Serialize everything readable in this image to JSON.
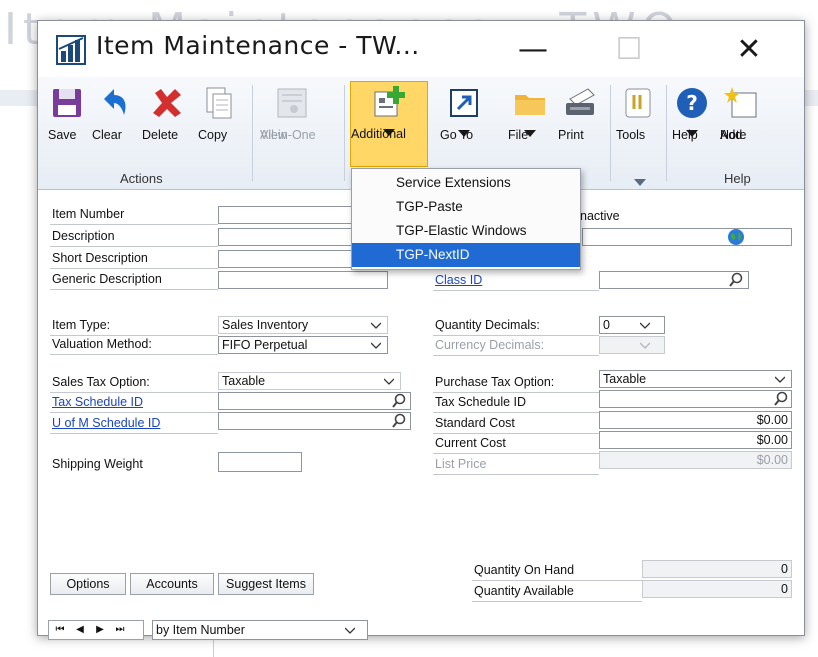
{
  "background": {
    "title_text": "Item Maintenance - TWO"
  },
  "window": {
    "title": "Item Maintenance  -  TW...",
    "minimize_glyph": "—",
    "maximize_glyph": "☐",
    "close_glyph": "✕"
  },
  "ribbon": {
    "buttons": [
      {
        "label": "Save",
        "icon": "save-icon"
      },
      {
        "label": "Clear",
        "icon": "undo-icon"
      },
      {
        "label": "Delete",
        "icon": "delete-x-icon"
      },
      {
        "label": "Copy",
        "icon": "copy-icon"
      },
      {
        "label": "All-in-One",
        "label2": "View",
        "icon": "all-in-one-view-icon",
        "disabled": true
      },
      {
        "label": "Additional",
        "icon": "additional-icon",
        "active": true
      },
      {
        "label": "Go To",
        "icon": "goto-icon"
      },
      {
        "label": "File",
        "icon": "folder-icon"
      },
      {
        "label": "Print",
        "icon": "printer-icon"
      },
      {
        "label": "Tools",
        "icon": "tools-icon"
      },
      {
        "label": "Help",
        "icon": "help-icon"
      },
      {
        "label": "Add",
        "label2": "Note",
        "icon": "note-icon"
      }
    ],
    "groups": {
      "actions": "Actions",
      "help": "Help"
    }
  },
  "menu": {
    "items": [
      {
        "label": "Service Extensions"
      },
      {
        "label": "TGP-Paste"
      },
      {
        "label": "TGP-Elastic Windows"
      },
      {
        "label": "TGP-NextID",
        "selected": true
      }
    ]
  },
  "form": {
    "item_number": "Item Number",
    "description": "Description",
    "short_description": "Short Description",
    "generic_description": "Generic Description",
    "inactive": "nactive",
    "class_id": "Class ID",
    "item_type": {
      "label": "Item Type:",
      "value": "Sales Inventory"
    },
    "valuation_method": {
      "label": "Valuation Method:",
      "value": "FIFO Perpetual"
    },
    "quantity_decimals": {
      "label": "Quantity Decimals:",
      "value": "0"
    },
    "currency_decimals": {
      "label": "Currency Decimals:",
      "value": ""
    },
    "sales_tax_option": {
      "label": "Sales Tax Option:",
      "value": "Taxable"
    },
    "tax_schedule_id": "Tax Schedule ID",
    "u_of_m_schedule_id": "U of M Schedule ID",
    "shipping_weight": "Shipping Weight",
    "purchase_tax_option": {
      "label": "Purchase Tax Option:",
      "value": "Taxable"
    },
    "purchase_tax_schedule_id": "Tax Schedule ID",
    "standard_cost": {
      "label": "Standard Cost",
      "value": "$0.00"
    },
    "current_cost": {
      "label": "Current Cost",
      "value": "$0.00"
    },
    "list_price": {
      "label": "List Price",
      "value": "$0.00"
    },
    "quantity_on_hand": {
      "label": "Quantity On Hand",
      "value": "0"
    },
    "quantity_available": {
      "label": "Quantity Available",
      "value": "0"
    }
  },
  "bottom": {
    "options_button": "Options",
    "accounts_button": "Accounts",
    "suggest_items_button": "Suggest Items",
    "sort_by": "by Item Number"
  },
  "colors": {
    "accent": "#ffd766",
    "selection": "#1f6ad3",
    "link": "#1a44c2"
  }
}
